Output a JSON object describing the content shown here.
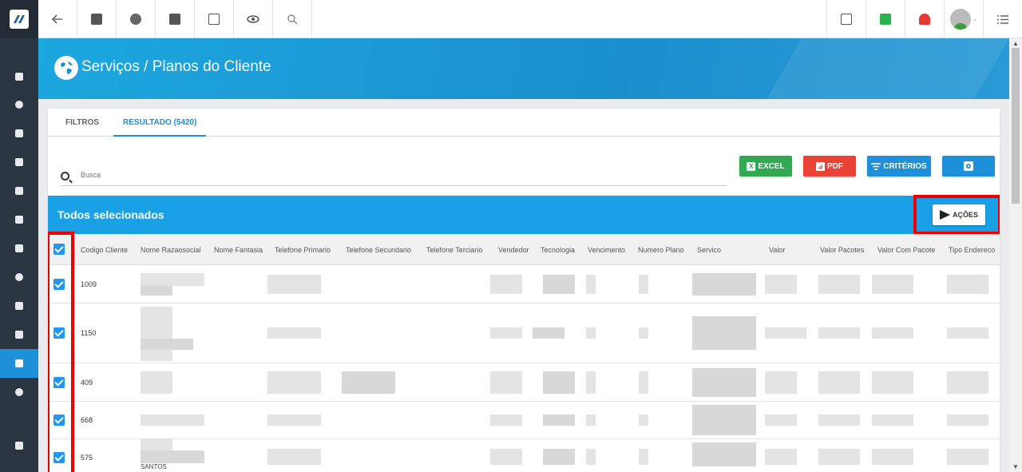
{
  "page": {
    "title": "Serviços / Planos do Cliente"
  },
  "tabs": [
    {
      "label": "FILTROS"
    },
    {
      "label": "RESULTADO (5420)"
    }
  ],
  "search": {
    "placeholder": "Busca"
  },
  "toolbar": {
    "excel": "EXCEL",
    "pdf": "PDF",
    "criterios": "CRITÉRIOS"
  },
  "selection": {
    "text": "Todos selecionados",
    "actions_label": "AÇÕES"
  },
  "table": {
    "columns": [
      "Codigo Cliente",
      "Nome Razaosocial",
      "Nome Fantasia",
      "Telefone Primario",
      "Telefone Secundario",
      "Telefone Terciario",
      "Vendedor",
      "Tecnologia",
      "Vencimento",
      "Numero Plano",
      "Servico",
      "Valor",
      "Valor Pacotes",
      "Valor Com Pacote",
      "Tipo Endereco"
    ],
    "rows": [
      {
        "code": "1009"
      },
      {
        "code": "1150"
      },
      {
        "code": "409"
      },
      {
        "code": "668"
      },
      {
        "code": "575"
      }
    ],
    "partial_text": "SANTOS"
  },
  "icons": {
    "sidebar": [
      "dashboard-icon",
      "chart-icon",
      "contact-icon",
      "kanban-icon",
      "calendar-icon",
      "box-icon",
      "money-icon",
      "map-pin-icon",
      "document-icon",
      "server-icon",
      "file-icon",
      "gear-icon",
      "video-icon"
    ],
    "topbar": [
      "back-arrow-icon",
      "contact-card-icon",
      "calendar-clock-icon",
      "dollar-icon",
      "terminal-icon",
      "eye-icon",
      "search-icon",
      "pdf-file-icon",
      "chat-check-icon",
      "alarm-bell-icon",
      "user-avatar",
      "list-menu-icon"
    ]
  },
  "colors": {
    "primary": "#1e90d9",
    "selection_bar": "#1aa0e4",
    "excel": "#33a853",
    "pdf": "#ea4335",
    "highlight": "#ee0000",
    "sidebar": "#2b3441"
  }
}
